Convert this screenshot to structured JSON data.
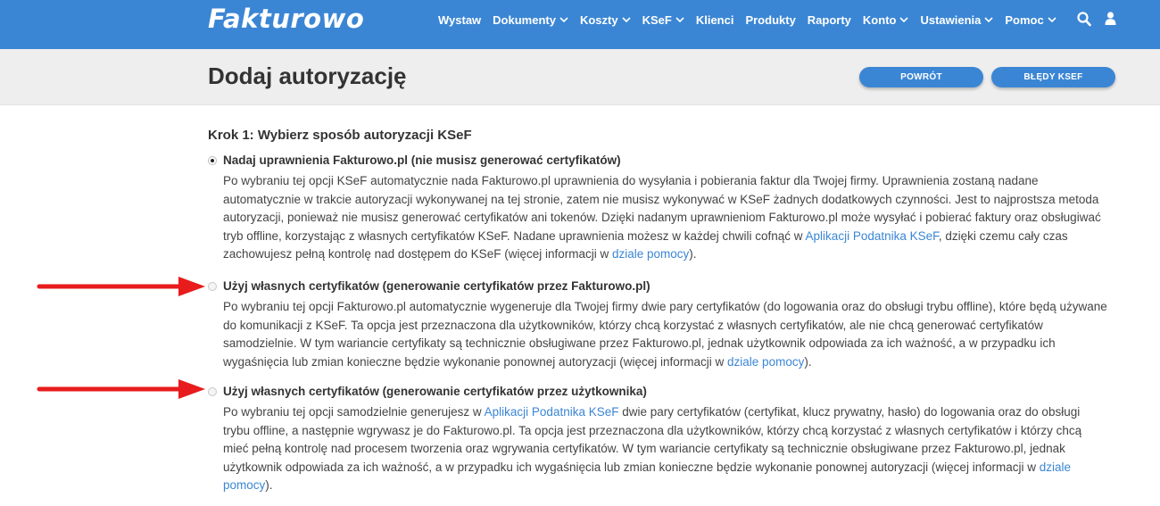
{
  "brand": {
    "name": "Fakturowo"
  },
  "nav": [
    {
      "label": "Wystaw",
      "dropdown": false
    },
    {
      "label": "Dokumenty",
      "dropdown": true
    },
    {
      "label": "Koszty",
      "dropdown": true
    },
    {
      "label": "KSeF",
      "dropdown": true
    },
    {
      "label": "Klienci",
      "dropdown": false
    },
    {
      "label": "Produkty",
      "dropdown": false
    },
    {
      "label": "Raporty",
      "dropdown": false
    },
    {
      "label": "Konto",
      "dropdown": true
    },
    {
      "label": "Ustawienia",
      "dropdown": true
    },
    {
      "label": "Pomoc",
      "dropdown": true
    }
  ],
  "header": {
    "title": "Dodaj autoryzację",
    "back_button": "POWRÓT",
    "errors_button": "BŁĘDY KSEF"
  },
  "step": {
    "title": "Krok 1: Wybierz sposób autoryzacji KSeF"
  },
  "options": [
    {
      "label": "Nadaj uprawnienia Fakturowo.pl (nie musisz generować certyfikatów)",
      "selected": true,
      "d1": "Po wybraniu tej opcji KSeF automatycznie nada Fakturowo.pl uprawnienia do wysyłania i pobierania faktur dla Twojej firmy. Uprawnienia zostaną nadane automatycznie w trakcie autoryzacji wykonywanej na tej stronie, zatem nie musisz wykonywać w KSeF żadnych dodatkowych czynności. Jest to najprostsza metoda autoryzacji, ponieważ nie musisz generować certyfikatów ani tokenów. Dzięki nadanym uprawnieniom Fakturowo.pl może wysyłać i pobierać faktury oraz obsługiwać tryb offline, korzystając z własnych certyfikatów KSeF. Nadane uprawnienia możesz w każdej chwili cofnąć w ",
      "link1": "Aplikacji Podatnika KSeF",
      "d2": ", dzięki czemu cały czas zachowujesz pełną kontrolę nad dostępem do KSeF (więcej informacji w ",
      "link2": "dziale pomocy",
      "d3": ")."
    },
    {
      "label": "Użyj własnych certyfikatów (generowanie certyfikatów przez Fakturowo.pl)",
      "selected": false,
      "d1": "Po wybraniu tej opcji Fakturowo.pl automatycznie wygeneruje dla Twojej firmy dwie pary certyfikatów (do logowania oraz do obsługi trybu offline), które będą używane do komunikacji z KSeF. Ta opcja jest przeznaczona dla użytkowników, którzy chcą korzystać z własnych certyfikatów, ale nie chcą generować certyfikatów samodzielnie. W tym wariancie certyfikaty są technicznie obsługiwane przez Fakturowo.pl, jednak użytkownik odpowiada za ich ważność, a w przypadku ich wygaśnięcia lub zmian konieczne będzie wykonanie ponownej autoryzacji (więcej informacji w ",
      "link1": "dziale pomocy",
      "d2": ")."
    },
    {
      "label": "Użyj własnych certyfikatów (generowanie certyfikatów przez użytkownika)",
      "selected": false,
      "d1": "Po wybraniu tej opcji samodzielnie generujesz w ",
      "link1": "Aplikacji Podatnika KSeF",
      "d2": " dwie pary certyfikatów (certyfikat, klucz prywatny, hasło) do logowania oraz do obsługi trybu offline, a następnie wgrywasz je do Fakturowo.pl. Ta opcja jest przeznaczona dla użytkowników, którzy chcą korzystać z własnych certyfikatów i którzy chcą mieć pełną kontrolę nad procesem tworzenia oraz wgrywania certyfikatów. W tym wariancie certyfikaty są technicznie obsługiwane przez Fakturowo.pl, jednak użytkownik odpowiada za ich ważność, a w przypadku ich wygaśnięcia lub zmian konieczne będzie wykonanie ponownej autoryzacji (więcej informacji w ",
      "link2": "dziale pomocy",
      "d3": ")."
    }
  ],
  "colors": {
    "primary": "#3b86d4",
    "arrow": "#e81c1c",
    "header_band": "#eeeeee"
  }
}
